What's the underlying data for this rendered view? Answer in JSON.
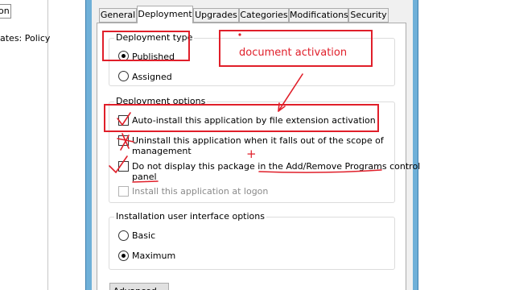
{
  "background": {
    "tree_node_text": "on",
    "policy_text": "ates: Policy"
  },
  "tabs": [
    {
      "label": "General",
      "active": false
    },
    {
      "label": "Deployment",
      "active": true
    },
    {
      "label": "Upgrades",
      "active": false
    },
    {
      "label": "Categories",
      "active": false
    },
    {
      "label": "Modifications",
      "active": false
    },
    {
      "label": "Security",
      "active": false
    }
  ],
  "deployment_type": {
    "title": "Deployment type",
    "options": [
      {
        "label": "Published",
        "selected": true
      },
      {
        "label": "Assigned",
        "selected": false
      }
    ]
  },
  "deployment_options": {
    "title": "Deployment options",
    "items": [
      {
        "label": "Auto-install this application by file extension activation",
        "checked": true,
        "enabled": true
      },
      {
        "label_line1": "Uninstall this application when it falls out of the scope of",
        "label_line2": "management",
        "checked": false,
        "enabled": true
      },
      {
        "label_line1": "Do not display this package in the Add/Remove Programs control",
        "label_line2": "panel",
        "checked": false,
        "enabled": true
      },
      {
        "label": "Install this application at logon",
        "checked": false,
        "enabled": false
      }
    ]
  },
  "installation_ui": {
    "title": "Installation user interface options",
    "options": [
      {
        "label": "Basic",
        "selected": false
      },
      {
        "label": "Maximum",
        "selected": true
      }
    ]
  },
  "buttons": {
    "advanced": "Advanced..."
  },
  "annotations": {
    "callout": "document activation",
    "plus": "+",
    "color": "#e01f2a"
  },
  "colors": {
    "window_frame": "#6fb0d8",
    "dialog_bg": "#f0f0f0",
    "panel_bg": "#ffffff"
  }
}
